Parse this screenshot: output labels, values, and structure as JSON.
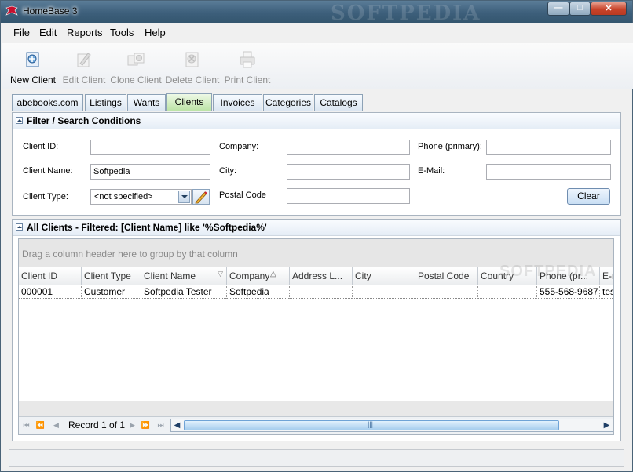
{
  "window": {
    "title": "HomeBase 3",
    "watermark": "SOFTPEDIA",
    "controls": {
      "minimize": "—",
      "maximize": "□",
      "close": "✕"
    }
  },
  "menu": [
    "File",
    "Edit",
    "Reports",
    "Tools",
    "Help"
  ],
  "toolbar": [
    {
      "label": "New Client",
      "icon": "new-client-icon",
      "enabled": true
    },
    {
      "label": "Edit Client",
      "icon": "edit-client-icon",
      "enabled": false
    },
    {
      "label": "Clone Client",
      "icon": "clone-client-icon",
      "enabled": false
    },
    {
      "label": "Delete Client",
      "icon": "delete-client-icon",
      "enabled": false
    },
    {
      "label": "Print Client",
      "icon": "print-client-icon",
      "enabled": false
    }
  ],
  "tabs": [
    "abebooks.com",
    "Listings",
    "Wants",
    "Clients",
    "Invoices",
    "Categories",
    "Catalogs"
  ],
  "active_tab": "Clients",
  "filter": {
    "title": "Filter / Search Conditions",
    "client_id_label": "Client ID:",
    "client_id_value": "",
    "client_name_label": "Client Name:",
    "client_name_value": "Softpedia",
    "client_type_label": "Client Type:",
    "client_type_value": "<not specified>",
    "company_label": "Company:",
    "company_value": "",
    "city_label": "City:",
    "city_value": "",
    "postal_label": "Postal Code",
    "postal_value": "",
    "phone_label": "Phone (primary):",
    "phone_value": "",
    "email_label": "E-Mail:",
    "email_value": "",
    "clear_label": "Clear"
  },
  "clients": {
    "title": "All Clients - Filtered: [Client Name] like '%Softpedia%'",
    "group_hint": "Drag a column header here to group by that column",
    "columns": [
      "Client ID",
      "Client Type",
      "Client Name",
      "Company",
      "Address L...",
      "City",
      "Postal Code",
      "Country",
      "Phone (pr...",
      "E-m"
    ],
    "rows": [
      [
        "000001",
        "Customer",
        "Softpedia Tester",
        "Softpedia",
        "",
        "",
        "",
        "",
        "555-568-9687",
        "tes"
      ]
    ],
    "record_label": "Record 1 of 1",
    "watermark": "SOFTPEDIA"
  },
  "colors": {
    "active_tab": "#b9e3a3",
    "titlebar": "#3d5f7b",
    "scroll_thumb": "#a6cdee"
  }
}
